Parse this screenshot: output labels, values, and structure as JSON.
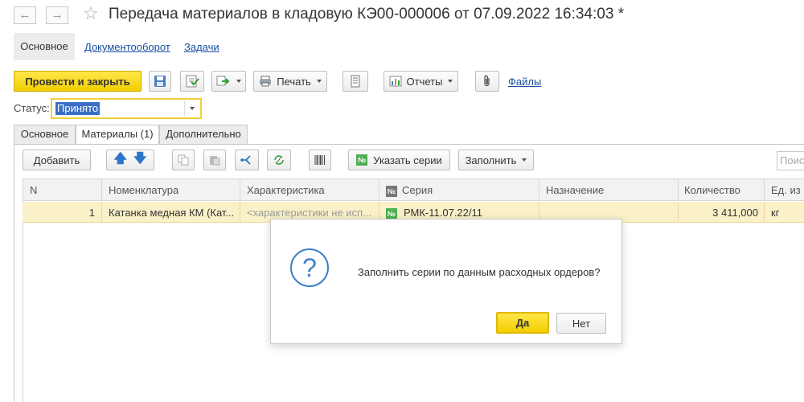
{
  "window": {
    "title": "Передача материалов в кладовую КЭ00-000006 от 07.09.2022 16:34:03 *",
    "back_glyph": "←",
    "forward_glyph": "→",
    "star_glyph": "☆"
  },
  "top_tabs": {
    "main": "Основное",
    "docflow": "Документооборот",
    "tasks": "Задачи"
  },
  "toolbar": {
    "post_close": "Провести и закрыть",
    "print": "Печать",
    "reports": "Отчеты",
    "files": "Файлы"
  },
  "status": {
    "label": "Статус:",
    "value": "Принято"
  },
  "form_tabs": {
    "main": "Основное",
    "materials": "Материалы (1)",
    "additional": "Дополнительно"
  },
  "table_toolbar": {
    "add": "Добавить",
    "specify_series": "Указать серии",
    "fill": "Заполнить",
    "search_placeholder": "Поиск"
  },
  "table": {
    "headers": {
      "n": "N",
      "item": "Номенклатура",
      "characteristic": "Характеристика",
      "series": "Серия",
      "purpose": "Назначение",
      "quantity": "Количество",
      "unit": "Ед. из"
    },
    "rows": [
      {
        "n": "1",
        "item": "Катанка медная КМ (Кат...",
        "characteristic": "<характеристики не исп...",
        "series": "РМК-11.07.22/11",
        "purpose": "",
        "quantity": "3 411,000",
        "unit": "кг"
      }
    ]
  },
  "dialog": {
    "icon": "?",
    "message": "Заполнить серии по данным расходных ордеров?",
    "yes": "Да",
    "no": "Нет"
  },
  "colors": {
    "accent_yellow": "#f2cf00",
    "link_blue": "#1a4fa0",
    "selected_row": "#fbf1c8",
    "question_blue": "#3f7fc8"
  }
}
